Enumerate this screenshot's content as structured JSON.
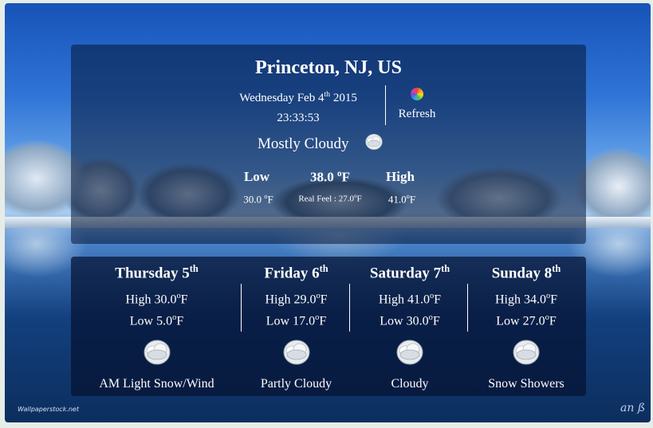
{
  "location": {
    "city": "Princeton, NJ, US"
  },
  "datetime": {
    "date_prefix": "Wednesday Feb 4",
    "date_suffix": "th",
    "year": "2015",
    "time": "23:33:53"
  },
  "refresh": {
    "label": "Refresh",
    "icon": "refresh-color-wheel-icon"
  },
  "current": {
    "condition": "Mostly Cloudy",
    "icon": "mostly-cloudy-icon",
    "low_label": "Low",
    "temp": "38.0",
    "high_label": "High",
    "low_value": "30.0",
    "real_feel_label": "Real Feel : 27.0",
    "high_value": "41.0",
    "unit_sup": "o",
    "unit_letter": "F"
  },
  "forecast": [
    {
      "day": "Thursday 5",
      "suffix": "th",
      "high": "High 30.0",
      "low": "Low 5.0",
      "desc": "AM Light Snow/Wind",
      "icon": "snow-cloud-icon"
    },
    {
      "day": "Friday 6",
      "suffix": "th",
      "high": "High 29.0",
      "low": "Low 17.0",
      "desc": "Partly Cloudy",
      "icon": "partly-cloudy-icon"
    },
    {
      "day": "Saturday 7",
      "suffix": "th",
      "high": "High 41.0",
      "low": "Low 30.0",
      "desc": "Cloudy",
      "icon": "cloudy-icon"
    },
    {
      "day": "Sunday 8",
      "suffix": "th",
      "high": "High 34.0",
      "low": "Low 27.0",
      "desc": "Snow Showers",
      "icon": "snow-showers-icon"
    }
  ],
  "background": {
    "watermark": "Wallpaperstock.net",
    "signature": "an ß"
  }
}
